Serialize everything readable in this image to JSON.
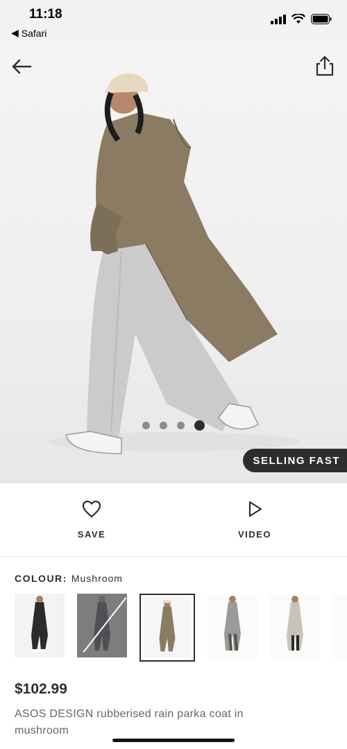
{
  "status": {
    "time": "11:18",
    "back_app": "Safari"
  },
  "nav": {
    "back_icon": "arrow-left-icon",
    "share_icon": "share-icon"
  },
  "gallery": {
    "image_count": 4,
    "active_index": 3,
    "badge": "SELLING FAST"
  },
  "actions": {
    "save_label": "SAVE",
    "video_label": "VIDEO"
  },
  "colour": {
    "label": "COLOUR:",
    "value": "Mushroom",
    "swatches": [
      {
        "name": "black",
        "color": "#2b2b2b",
        "out_of_stock": false,
        "selected": false
      },
      {
        "name": "navy",
        "color": "#2f3645",
        "out_of_stock": true,
        "selected": false
      },
      {
        "name": "mushroom",
        "color": "#8a7b62",
        "out_of_stock": false,
        "selected": true
      },
      {
        "name": "grey",
        "color": "#9a9a9a",
        "out_of_stock": false,
        "selected": false
      },
      {
        "name": "stone",
        "color": "#c8c3b8",
        "out_of_stock": false,
        "selected": false
      },
      {
        "name": "khaki",
        "color": "#5e5a45",
        "out_of_stock": false,
        "selected": false
      }
    ]
  },
  "product": {
    "price": "$102.99",
    "title": "ASOS DESIGN rubberised rain parka coat in mushroom"
  },
  "colors": {
    "accent": "#2d2d2d",
    "coat": "#8a7b62",
    "trousers": "#c9c9c9"
  }
}
